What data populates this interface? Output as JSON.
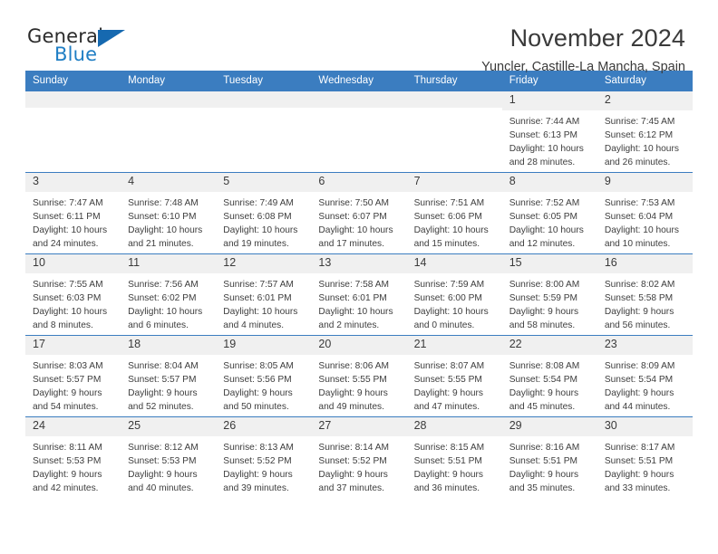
{
  "brand": {
    "name_top": "General",
    "name_bottom": "Blue",
    "color_primary": "#1669b0",
    "color_accent": "#1f7ec4"
  },
  "header": {
    "title": "November 2024",
    "subtitle": "Yuncler, Castille-La Mancha, Spain"
  },
  "calendar": {
    "header_bg": "#3b7dc0",
    "daynum_bg": "#f0f0f0",
    "weekday_headers": [
      "Sunday",
      "Monday",
      "Tuesday",
      "Wednesday",
      "Thursday",
      "Friday",
      "Saturday"
    ],
    "weeks": [
      [
        {
          "day": "",
          "sunrise": "",
          "sunset": "",
          "daylight": ""
        },
        {
          "day": "",
          "sunrise": "",
          "sunset": "",
          "daylight": ""
        },
        {
          "day": "",
          "sunrise": "",
          "sunset": "",
          "daylight": ""
        },
        {
          "day": "",
          "sunrise": "",
          "sunset": "",
          "daylight": ""
        },
        {
          "day": "",
          "sunrise": "",
          "sunset": "",
          "daylight": ""
        },
        {
          "day": "1",
          "sunrise": "Sunrise: 7:44 AM",
          "sunset": "Sunset: 6:13 PM",
          "daylight": "Daylight: 10 hours and 28 minutes."
        },
        {
          "day": "2",
          "sunrise": "Sunrise: 7:45 AM",
          "sunset": "Sunset: 6:12 PM",
          "daylight": "Daylight: 10 hours and 26 minutes."
        }
      ],
      [
        {
          "day": "3",
          "sunrise": "Sunrise: 7:47 AM",
          "sunset": "Sunset: 6:11 PM",
          "daylight": "Daylight: 10 hours and 24 minutes."
        },
        {
          "day": "4",
          "sunrise": "Sunrise: 7:48 AM",
          "sunset": "Sunset: 6:10 PM",
          "daylight": "Daylight: 10 hours and 21 minutes."
        },
        {
          "day": "5",
          "sunrise": "Sunrise: 7:49 AM",
          "sunset": "Sunset: 6:08 PM",
          "daylight": "Daylight: 10 hours and 19 minutes."
        },
        {
          "day": "6",
          "sunrise": "Sunrise: 7:50 AM",
          "sunset": "Sunset: 6:07 PM",
          "daylight": "Daylight: 10 hours and 17 minutes."
        },
        {
          "day": "7",
          "sunrise": "Sunrise: 7:51 AM",
          "sunset": "Sunset: 6:06 PM",
          "daylight": "Daylight: 10 hours and 15 minutes."
        },
        {
          "day": "8",
          "sunrise": "Sunrise: 7:52 AM",
          "sunset": "Sunset: 6:05 PM",
          "daylight": "Daylight: 10 hours and 12 minutes."
        },
        {
          "day": "9",
          "sunrise": "Sunrise: 7:53 AM",
          "sunset": "Sunset: 6:04 PM",
          "daylight": "Daylight: 10 hours and 10 minutes."
        }
      ],
      [
        {
          "day": "10",
          "sunrise": "Sunrise: 7:55 AM",
          "sunset": "Sunset: 6:03 PM",
          "daylight": "Daylight: 10 hours and 8 minutes."
        },
        {
          "day": "11",
          "sunrise": "Sunrise: 7:56 AM",
          "sunset": "Sunset: 6:02 PM",
          "daylight": "Daylight: 10 hours and 6 minutes."
        },
        {
          "day": "12",
          "sunrise": "Sunrise: 7:57 AM",
          "sunset": "Sunset: 6:01 PM",
          "daylight": "Daylight: 10 hours and 4 minutes."
        },
        {
          "day": "13",
          "sunrise": "Sunrise: 7:58 AM",
          "sunset": "Sunset: 6:01 PM",
          "daylight": "Daylight: 10 hours and 2 minutes."
        },
        {
          "day": "14",
          "sunrise": "Sunrise: 7:59 AM",
          "sunset": "Sunset: 6:00 PM",
          "daylight": "Daylight: 10 hours and 0 minutes."
        },
        {
          "day": "15",
          "sunrise": "Sunrise: 8:00 AM",
          "sunset": "Sunset: 5:59 PM",
          "daylight": "Daylight: 9 hours and 58 minutes."
        },
        {
          "day": "16",
          "sunrise": "Sunrise: 8:02 AM",
          "sunset": "Sunset: 5:58 PM",
          "daylight": "Daylight: 9 hours and 56 minutes."
        }
      ],
      [
        {
          "day": "17",
          "sunrise": "Sunrise: 8:03 AM",
          "sunset": "Sunset: 5:57 PM",
          "daylight": "Daylight: 9 hours and 54 minutes."
        },
        {
          "day": "18",
          "sunrise": "Sunrise: 8:04 AM",
          "sunset": "Sunset: 5:57 PM",
          "daylight": "Daylight: 9 hours and 52 minutes."
        },
        {
          "day": "19",
          "sunrise": "Sunrise: 8:05 AM",
          "sunset": "Sunset: 5:56 PM",
          "daylight": "Daylight: 9 hours and 50 minutes."
        },
        {
          "day": "20",
          "sunrise": "Sunrise: 8:06 AM",
          "sunset": "Sunset: 5:55 PM",
          "daylight": "Daylight: 9 hours and 49 minutes."
        },
        {
          "day": "21",
          "sunrise": "Sunrise: 8:07 AM",
          "sunset": "Sunset: 5:55 PM",
          "daylight": "Daylight: 9 hours and 47 minutes."
        },
        {
          "day": "22",
          "sunrise": "Sunrise: 8:08 AM",
          "sunset": "Sunset: 5:54 PM",
          "daylight": "Daylight: 9 hours and 45 minutes."
        },
        {
          "day": "23",
          "sunrise": "Sunrise: 8:09 AM",
          "sunset": "Sunset: 5:54 PM",
          "daylight": "Daylight: 9 hours and 44 minutes."
        }
      ],
      [
        {
          "day": "24",
          "sunrise": "Sunrise: 8:11 AM",
          "sunset": "Sunset: 5:53 PM",
          "daylight": "Daylight: 9 hours and 42 minutes."
        },
        {
          "day": "25",
          "sunrise": "Sunrise: 8:12 AM",
          "sunset": "Sunset: 5:53 PM",
          "daylight": "Daylight: 9 hours and 40 minutes."
        },
        {
          "day": "26",
          "sunrise": "Sunrise: 8:13 AM",
          "sunset": "Sunset: 5:52 PM",
          "daylight": "Daylight: 9 hours and 39 minutes."
        },
        {
          "day": "27",
          "sunrise": "Sunrise: 8:14 AM",
          "sunset": "Sunset: 5:52 PM",
          "daylight": "Daylight: 9 hours and 37 minutes."
        },
        {
          "day": "28",
          "sunrise": "Sunrise: 8:15 AM",
          "sunset": "Sunset: 5:51 PM",
          "daylight": "Daylight: 9 hours and 36 minutes."
        },
        {
          "day": "29",
          "sunrise": "Sunrise: 8:16 AM",
          "sunset": "Sunset: 5:51 PM",
          "daylight": "Daylight: 9 hours and 35 minutes."
        },
        {
          "day": "30",
          "sunrise": "Sunrise: 8:17 AM",
          "sunset": "Sunset: 5:51 PM",
          "daylight": "Daylight: 9 hours and 33 minutes."
        }
      ]
    ]
  }
}
